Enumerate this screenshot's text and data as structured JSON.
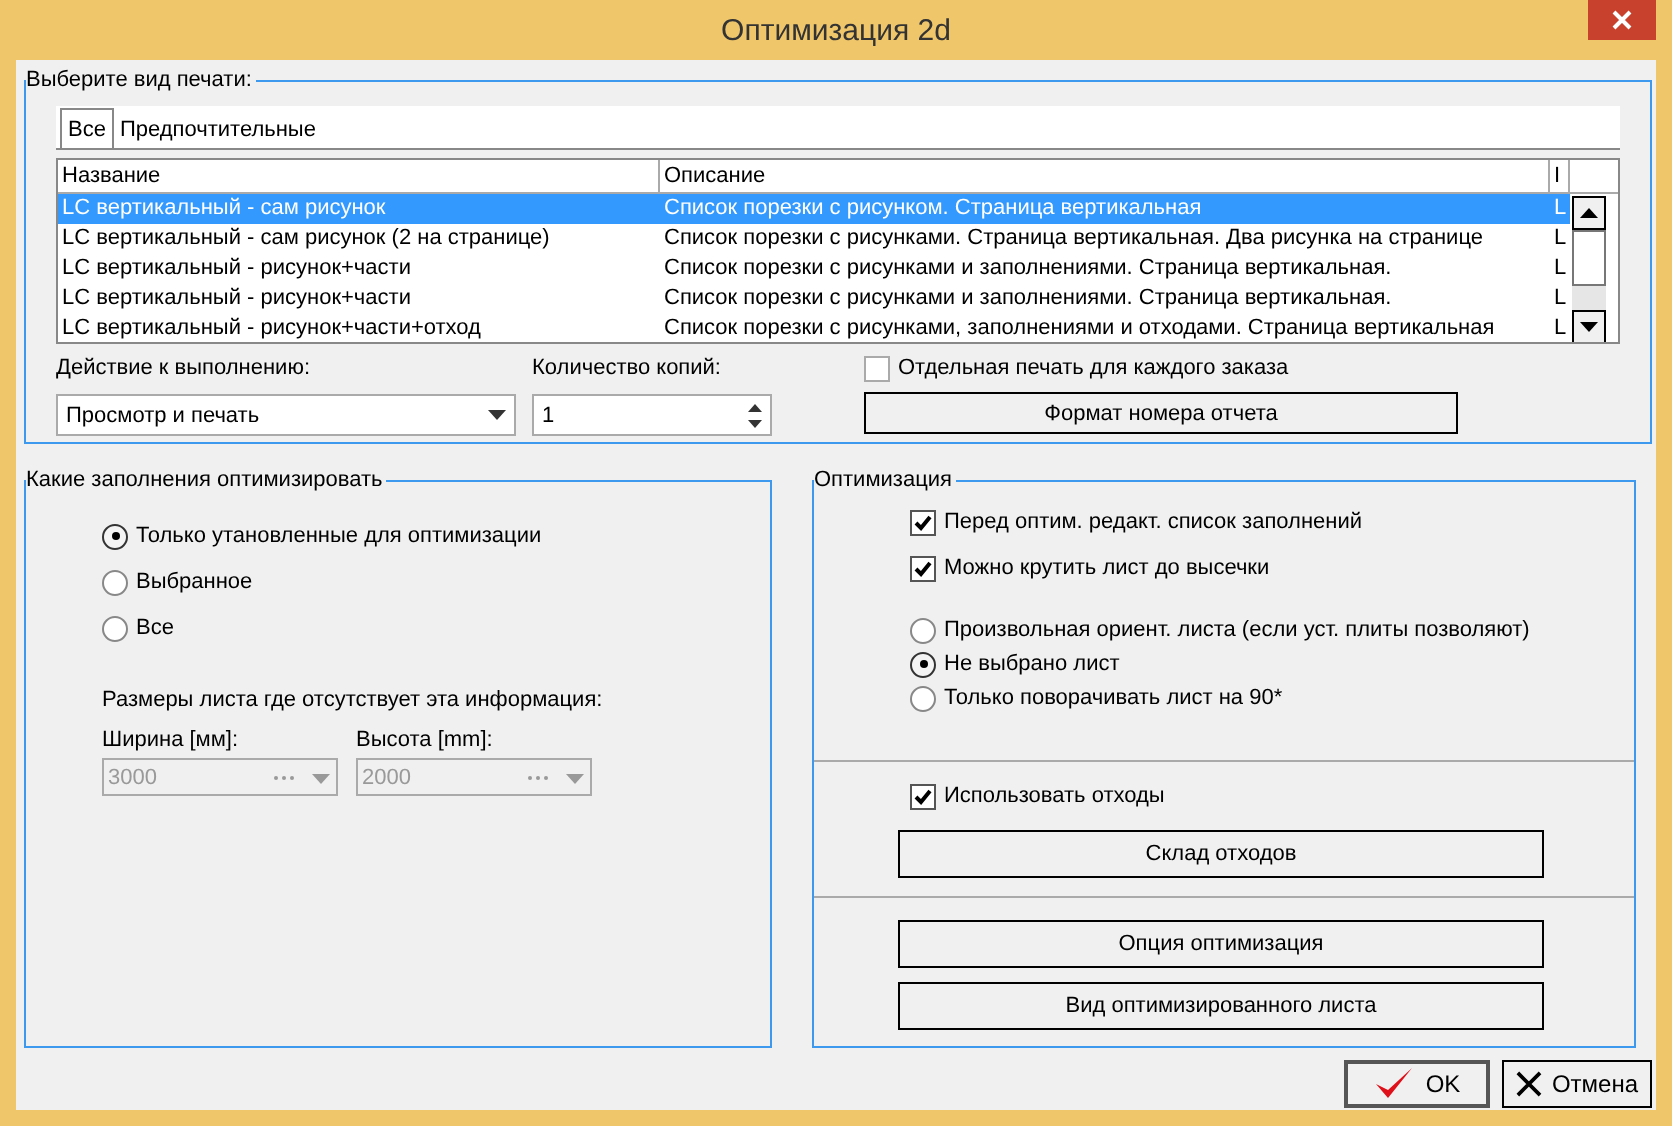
{
  "window": {
    "title": "Оптимизация 2d"
  },
  "print_group": {
    "title": "Выберите вид печати:",
    "tabs": [
      {
        "label": "Все",
        "selected": true
      },
      {
        "label": "Предпочтительные",
        "selected": false
      }
    ],
    "table": {
      "columns": [
        "Название",
        "Описание",
        "I"
      ],
      "rows": [
        {
          "cells": [
            "LC вертикальный - сам рисунок",
            "Список порезки с рисунком. Страница вертикальная",
            "L"
          ],
          "selected": true
        },
        {
          "cells": [
            "LC вертикальный - сам рисунок (2 на странице)",
            "Список порезки с рисунками. Страница вертикальная. Два рисунка на странице",
            "L"
          ],
          "selected": false
        },
        {
          "cells": [
            "LC вертикальный - рисунок+части",
            "Список порезки с рисунками и заполнениями. Страница вертикальная.",
            "L"
          ],
          "selected": false
        },
        {
          "cells": [
            "LC вертикальный - рисунок+части",
            "Список порезки с рисунками и заполнениями. Страница вертикальная.",
            "L"
          ],
          "selected": false
        },
        {
          "cells": [
            "LC вертикальный - рисунок+части+отход",
            "Список порезки с рисунками, заполнениями и отходами. Страница вертикальная",
            "L"
          ],
          "selected": false
        }
      ]
    },
    "action": {
      "label": "Действие к выполнению:",
      "value": "Просмотр и печать"
    },
    "copies": {
      "label": "Количество копий:",
      "value": "1"
    },
    "separate_print": {
      "label": "Отдельная печать для каждого заказа",
      "checked": false
    },
    "format_button": "Формат номера отчета"
  },
  "fill_group": {
    "title": "Какие заполнения оптимизировать",
    "options": [
      {
        "label": "Только утановленные для оптимизации",
        "selected": true
      },
      {
        "label": "Выбранное",
        "selected": false
      },
      {
        "label": "Все",
        "selected": false
      }
    ],
    "size_label": "Размеры листа где отсутствует эта информация:",
    "fields": [
      {
        "label": "Ширина [мм]:",
        "value": "3000",
        "disabled": true
      },
      {
        "label": "Высота [mm]:",
        "value": "2000",
        "disabled": true
      }
    ]
  },
  "opt_group": {
    "title": "Оптимизация",
    "checks": [
      {
        "label": "Перед оптим. редакт. список заполнений",
        "checked": true
      },
      {
        "label": "Можно крутить лист до высечки",
        "checked": true
      }
    ],
    "orientation": [
      {
        "label": "Произвольная ориент. листа (если уст. плиты позволяют)",
        "selected": false
      },
      {
        "label": "Не выбрано лист",
        "selected": true
      },
      {
        "label": "Только поворачивать лист на 90*",
        "selected": false
      }
    ],
    "use_waste": {
      "label": "Использовать отходы",
      "checked": true
    },
    "waste_button": "Склад отходов",
    "buttons": [
      "Опция оптимизация",
      "Вид оптимизированного листа"
    ]
  },
  "ok": "OK",
  "cancel": "Отмена"
}
